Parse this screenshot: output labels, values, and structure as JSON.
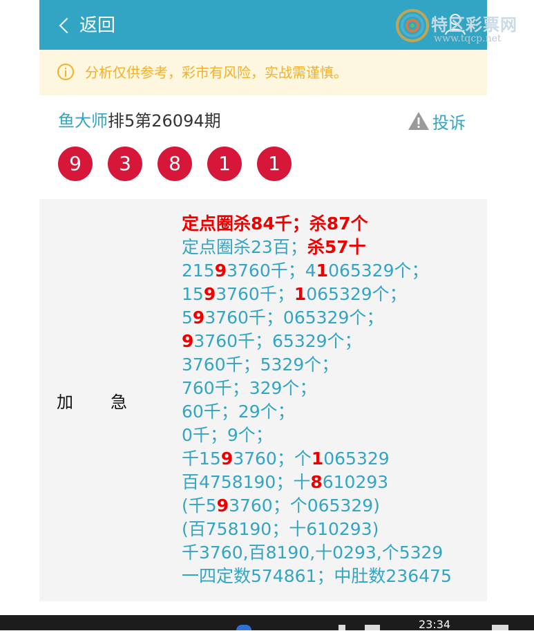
{
  "header": {
    "back_label": "返回",
    "watermark_title": "特区彩票网",
    "watermark_url": "www.tqcp.net"
  },
  "notice": {
    "text": "分析仅供参考，彩市有风险，实战需谨慎。"
  },
  "title": {
    "author": "鱼大师",
    "issue": "排5第26094期",
    "report_label": "投诉"
  },
  "balls": [
    "9",
    "3",
    "8",
    "1",
    "1"
  ],
  "panel": {
    "label_left": "加",
    "label_right": "急",
    "line_1a": "定点圈杀84千；",
    "line_1b": "杀87个",
    "line_2a": "定点圈杀23百；",
    "line_2b": "杀57十",
    "line_3": [
      "215",
      "9",
      "3760千；4",
      "1",
      "065329个；"
    ],
    "line_4": [
      "15",
      "9",
      "3760千；",
      "1",
      "065329个；"
    ],
    "line_5": [
      "5",
      "9",
      "3760千；065329个；"
    ],
    "line_6": [
      "9",
      "3760千；65329个；"
    ],
    "line_7": "3760千；5329个；",
    "line_8": "760千；329个；",
    "line_9": "60千；29个；",
    "line_10": "0千；9个；",
    "line_11": [
      "千15",
      "9",
      "3760；个",
      "1",
      "065329"
    ],
    "line_12": [
      "百4758190；十",
      "8",
      "610293"
    ],
    "line_13": [
      "(千5",
      "9",
      "3760；个065329)"
    ],
    "line_14": "(百758190；十610293)",
    "line_15": "千3760,百8190,十0293,个5329",
    "line_16": "一四定数574861；中肚数236475"
  },
  "taskbar": {
    "clock": "23:34"
  },
  "colors": {
    "accent": "#33a5c4",
    "ball": "#d6173a",
    "highlight": "#ee0000",
    "notice_bg": "#fdf7e0",
    "notice_text": "#f4b027"
  }
}
